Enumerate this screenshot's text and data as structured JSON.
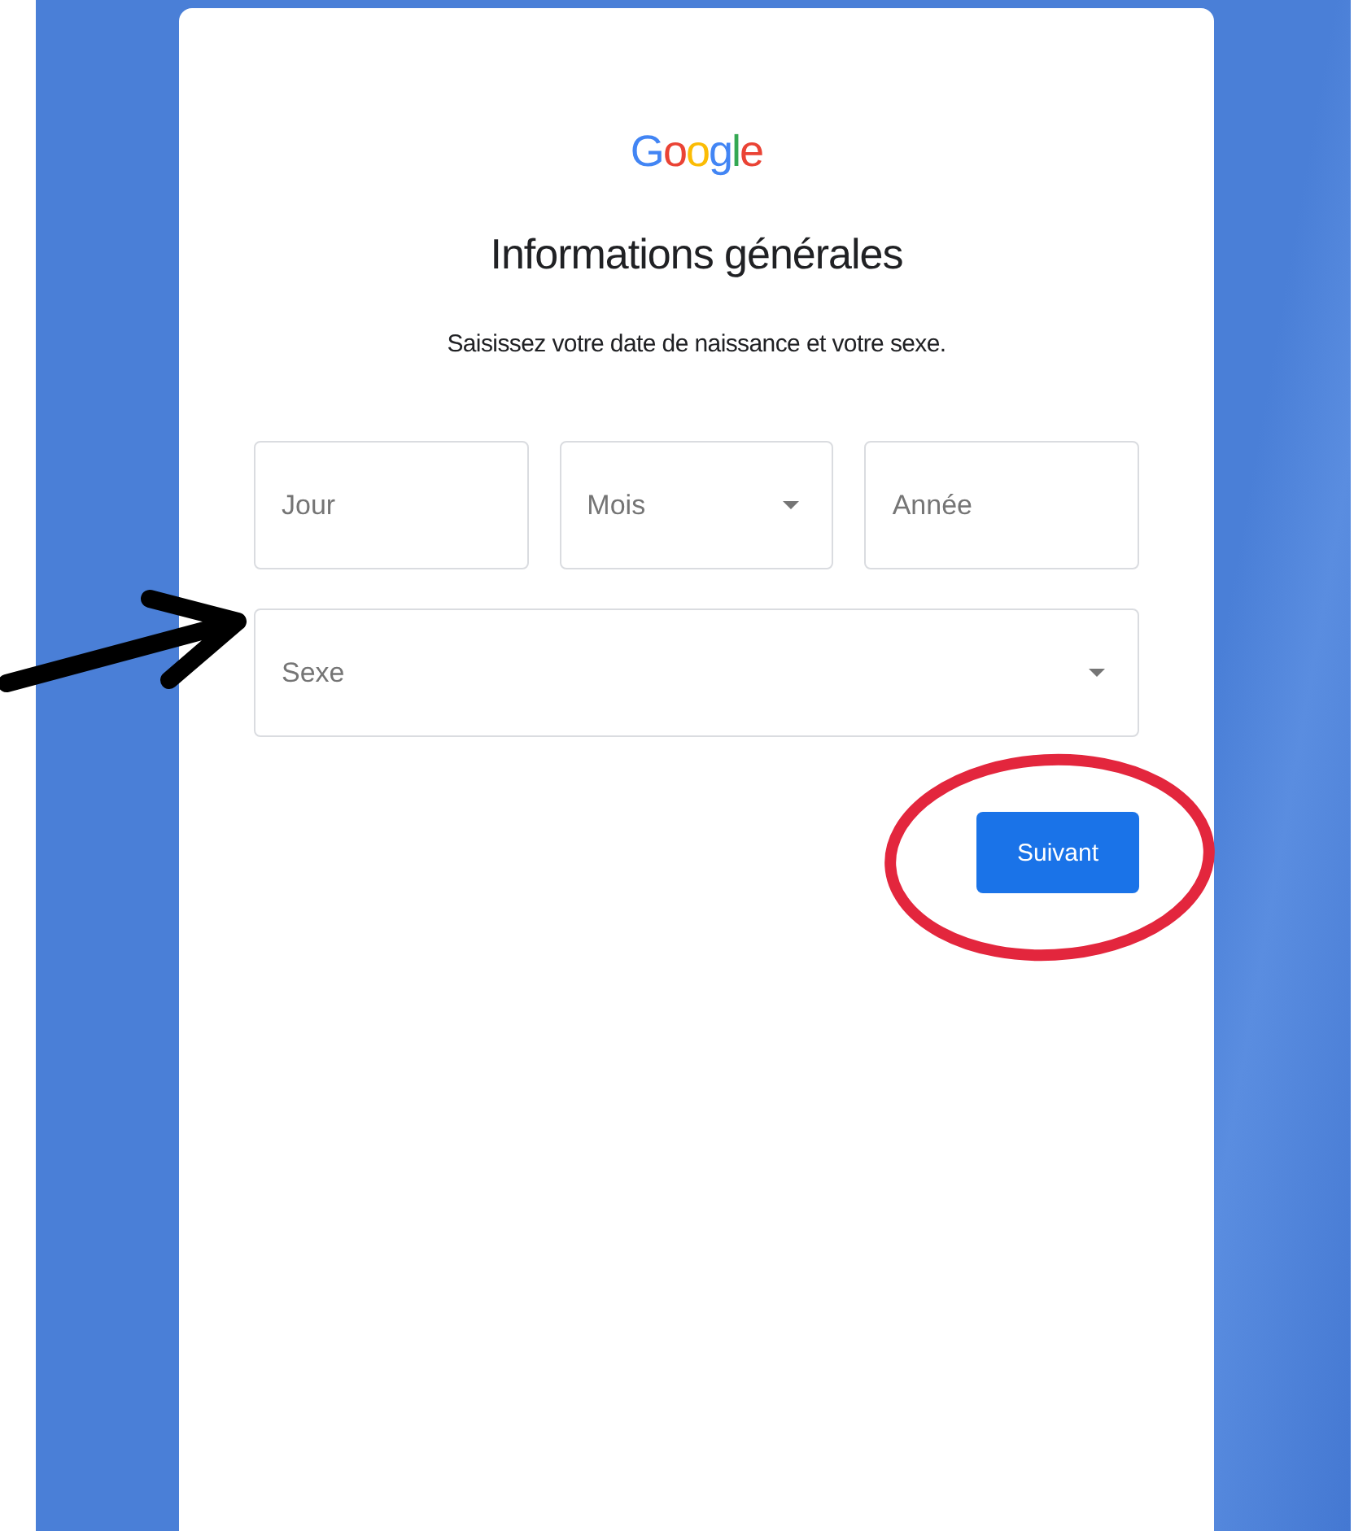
{
  "logo": "Google",
  "title": "Informations générales",
  "subtitle": "Saisissez votre date de naissance et votre sexe.",
  "date_fields": [
    {
      "kind": "input",
      "placeholder": "Jour"
    },
    {
      "kind": "select",
      "placeholder": "Mois"
    },
    {
      "kind": "input",
      "placeholder": "Année"
    }
  ],
  "gender_field": {
    "kind": "select",
    "placeholder": "Sexe"
  },
  "next_button": "Suivant"
}
